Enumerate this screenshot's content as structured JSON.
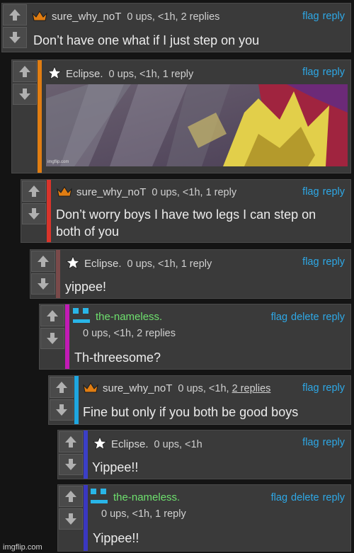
{
  "actions": {
    "flag": "flag",
    "delete": "delete",
    "reply": "reply"
  },
  "comments": [
    {
      "user": "sure_why_noT",
      "stats": "0 ups, <1h, 2 replies",
      "text": "Don’t have one what if I just step on you"
    },
    {
      "user": "Eclipse.",
      "stats": "0 ups, <1h, 1 reply",
      "image_watermark": "imgflip.com"
    },
    {
      "user": "sure_why_noT",
      "stats": "0 ups, <1h, 1 reply",
      "text1": "Don’t worry boys I have two legs I can step on",
      "text2": "both of you"
    },
    {
      "user": "Eclipse.",
      "stats": "0 ups, <1h, 1 reply",
      "text": "yippee!"
    },
    {
      "user": "the-nameless.",
      "stats": "0 ups, <1h, 2 replies",
      "text": "Th-threesome?"
    },
    {
      "user": "sure_why_noT",
      "stats_prefix": "0 ups, <1h,",
      "stats_link": "2 replies",
      "text": "Fine but only if you both be good boys"
    },
    {
      "user": "Eclipse.",
      "stats": "0 ups, <1h",
      "text": "Yippee!!"
    },
    {
      "user": "the-nameless.",
      "stats": "0 ups, <1h, 1 reply",
      "text": "Yippee!!"
    }
  ],
  "colors": {
    "orange": "#e07d12",
    "red": "#d9342b",
    "brown": "#7a4a4a",
    "magenta": "#c21bb5",
    "cyan": "#1ea6e0",
    "blue": "#3b3fc6",
    "indigo": "#3a37c0",
    "link": "#2ea8e6",
    "green_name": "#6ee06e"
  },
  "footer": "imgflip.com"
}
